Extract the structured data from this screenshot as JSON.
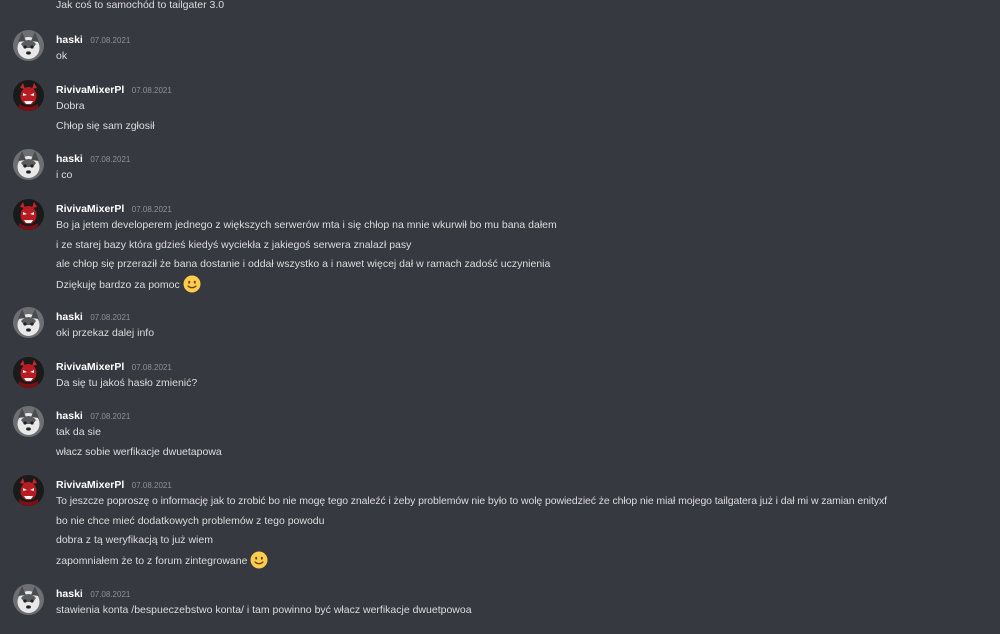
{
  "channel": {
    "top_cutoff_message": "Jak coś to samochód to tailgater 3.0"
  },
  "users": {
    "haski": {
      "name": "haski",
      "avatar_icon": "husky-dog-icon"
    },
    "riviva": {
      "name": "RivivaMixerPl",
      "avatar_icon": "red-demon-icon"
    }
  },
  "messages": [
    {
      "author": "haski",
      "timestamp": "07.08.2021",
      "lines": [
        "ok"
      ]
    },
    {
      "author": "RivivaMixerPl",
      "timestamp": "07.08.2021",
      "lines": [
        "Dobra",
        "Chłop się sam zgłosił"
      ]
    },
    {
      "author": "haski",
      "timestamp": "07.08.2021",
      "lines": [
        "i co"
      ]
    },
    {
      "author": "RivivaMixerPl",
      "timestamp": "07.08.2021",
      "lines": [
        "Bo ja jetem developerem jednego z większych serwerów mta i się chłop na mnie wkurwił bo mu bana dałem",
        "i ze starej bazy która gdzieś kiedyś wyciekła z jakiegoś serwera znalazł pasy",
        "ale chłop się przeraził że bana dostanie i oddał wszystko a i nawet więcej dał w ramach zadość uczynienia",
        "Dziękuję bardzo za pomoc"
      ],
      "emoji_after_last_line": "slightly-smiling-face-icon"
    },
    {
      "author": "haski",
      "timestamp": "07.08.2021",
      "lines": [
        "oki przekaz dalej info"
      ]
    },
    {
      "author": "RivivaMixerPl",
      "timestamp": "07.08.2021",
      "lines": [
        "Da się tu jakoś hasło zmienić?"
      ]
    },
    {
      "author": "haski",
      "timestamp": "07.08.2021",
      "lines": [
        "tak da sie",
        "włacz sobie werfikacje dwuetapowa"
      ]
    },
    {
      "author": "RivivaMixerPl",
      "timestamp": "07.08.2021",
      "lines": [
        "To jeszcze poproszę o informację jak to zrobić bo nie mogę tego znaleźć i żeby problemów nie było to wolę powiedzieć że chłop nie miał mojego tailgatera już i dał mi w zamian enityxf",
        "bo nie chce mieć dodatkowych problemów z tego powodu",
        "dobra z tą weryfikacją to już wiem",
        "zapomniałem że to z forum zintegrowane"
      ],
      "emoji_after_last_line": "slightly-smiling-face-icon"
    },
    {
      "author": "haski",
      "timestamp": "07.08.2021",
      "lines": [
        "stawienia konta /bespueczebstwo konta/ i tam powinno być włacz werfikacje dwuetpowoa"
      ]
    }
  ],
  "colors": {
    "background": "#36393f",
    "username": "#ffffff",
    "message_text": "#dcddde",
    "timestamp": "#8e9297",
    "emoji": "#ffcc4d"
  }
}
